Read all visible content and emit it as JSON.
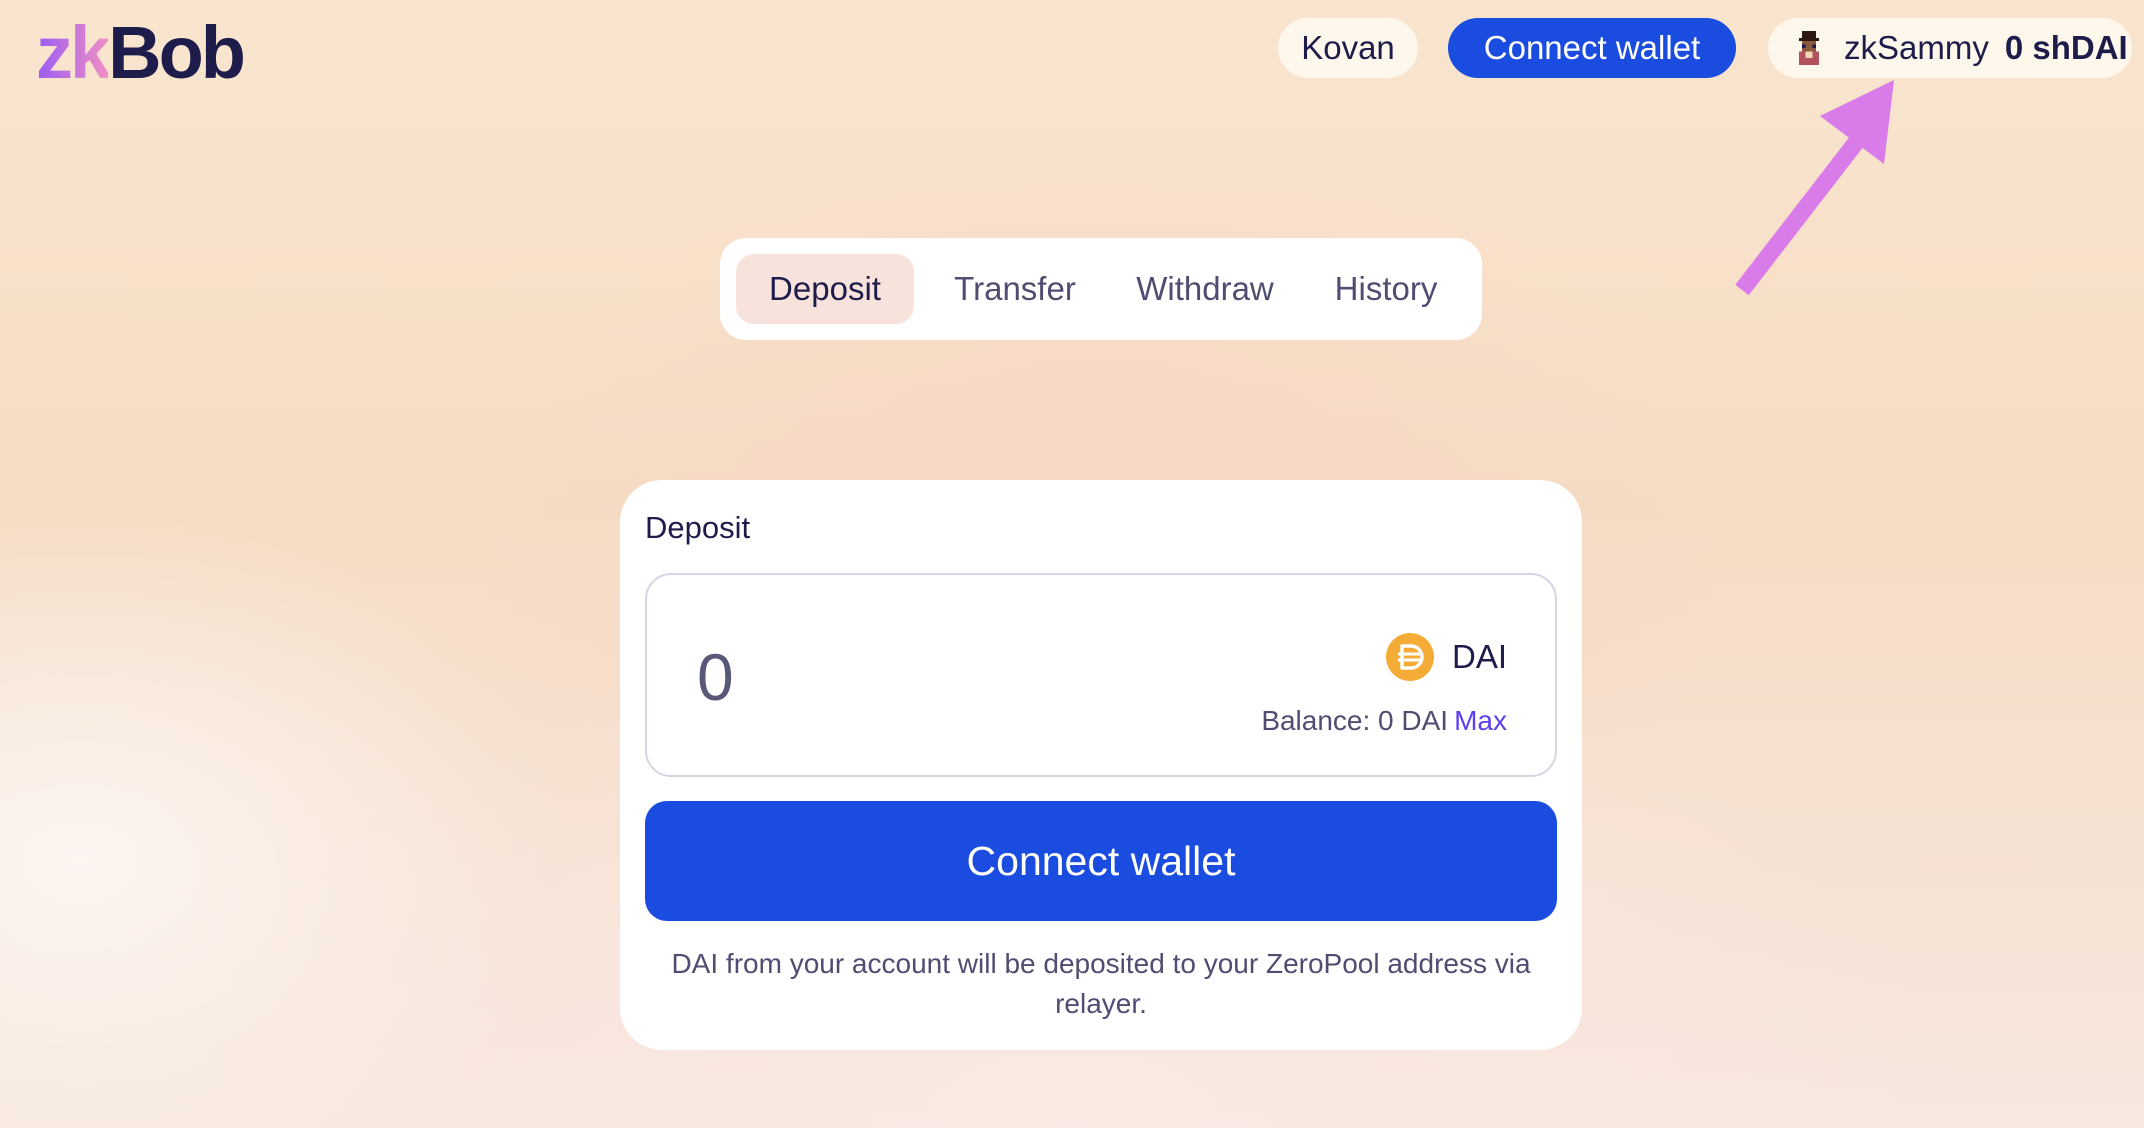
{
  "logo": {
    "part1": "zk",
    "part2": "Bob"
  },
  "header": {
    "network_label": "Kovan",
    "connect_label": "Connect wallet",
    "account_name": "zkSammy",
    "account_balance": "0 shDAI",
    "avatar_icon": "pixel-avatar-icon"
  },
  "annotation": {
    "arrow_icon": "arrow-up-right-icon",
    "arrow_color": "#d97be8"
  },
  "tabs": [
    {
      "label": "Deposit",
      "active": true
    },
    {
      "label": "Transfer",
      "active": false
    },
    {
      "label": "Withdraw",
      "active": false
    },
    {
      "label": "History",
      "active": false
    }
  ],
  "card": {
    "title": "Deposit",
    "amount_value": "0",
    "token_symbol": "DAI",
    "token_icon": "dai-icon",
    "balance_label": "Balance: 0 DAI",
    "max_label": "Max",
    "connect_label": "Connect wallet",
    "note": "DAI from your account will be deposited to your ZeroPool address via relayer."
  },
  "colors": {
    "accent_blue": "#1a4ce0",
    "link_purple": "#5b3ff0",
    "dai_orange": "#f5ac37",
    "active_tab_bg": "#f7e2dc"
  }
}
